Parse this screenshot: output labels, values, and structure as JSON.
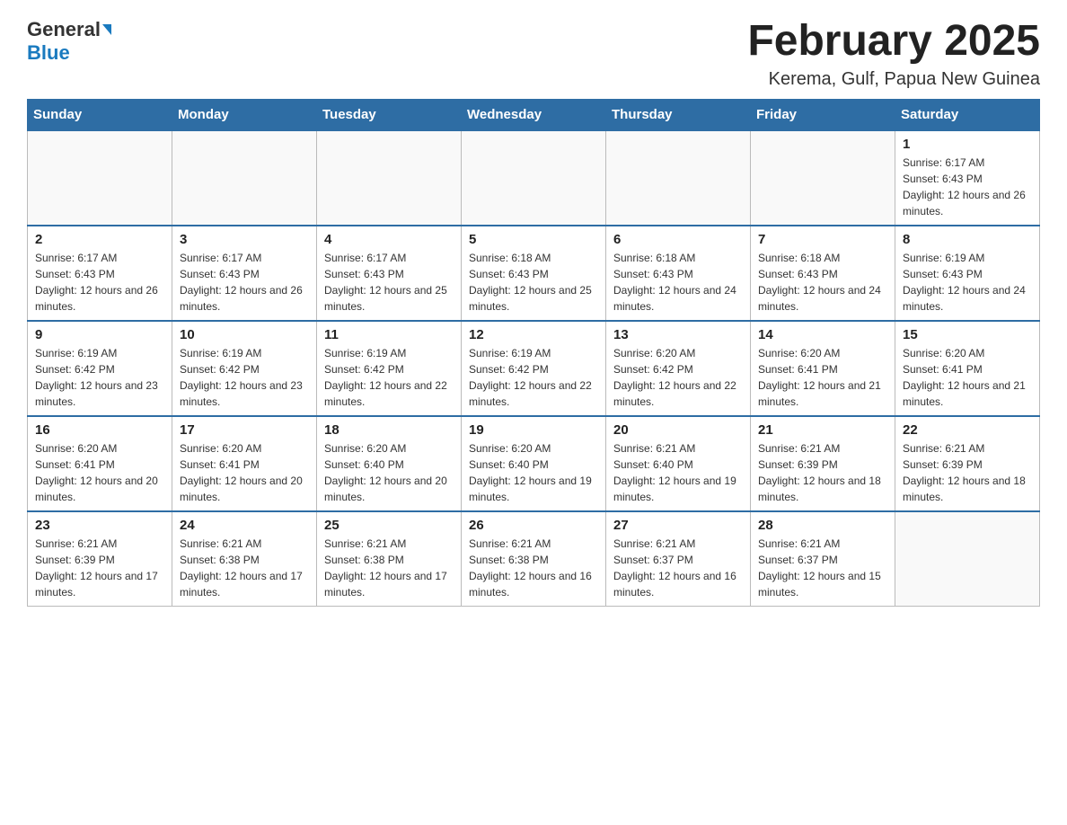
{
  "header": {
    "logo": {
      "general": "General",
      "arrow": "▶",
      "blue": "Blue"
    },
    "title": "February 2025",
    "subtitle": "Kerema, Gulf, Papua New Guinea"
  },
  "calendar": {
    "days_of_week": [
      "Sunday",
      "Monday",
      "Tuesday",
      "Wednesday",
      "Thursday",
      "Friday",
      "Saturday"
    ],
    "weeks": [
      [
        {
          "day": "",
          "info": ""
        },
        {
          "day": "",
          "info": ""
        },
        {
          "day": "",
          "info": ""
        },
        {
          "day": "",
          "info": ""
        },
        {
          "day": "",
          "info": ""
        },
        {
          "day": "",
          "info": ""
        },
        {
          "day": "1",
          "info": "Sunrise: 6:17 AM\nSunset: 6:43 PM\nDaylight: 12 hours and 26 minutes."
        }
      ],
      [
        {
          "day": "2",
          "info": "Sunrise: 6:17 AM\nSunset: 6:43 PM\nDaylight: 12 hours and 26 minutes."
        },
        {
          "day": "3",
          "info": "Sunrise: 6:17 AM\nSunset: 6:43 PM\nDaylight: 12 hours and 26 minutes."
        },
        {
          "day": "4",
          "info": "Sunrise: 6:17 AM\nSunset: 6:43 PM\nDaylight: 12 hours and 25 minutes."
        },
        {
          "day": "5",
          "info": "Sunrise: 6:18 AM\nSunset: 6:43 PM\nDaylight: 12 hours and 25 minutes."
        },
        {
          "day": "6",
          "info": "Sunrise: 6:18 AM\nSunset: 6:43 PM\nDaylight: 12 hours and 24 minutes."
        },
        {
          "day": "7",
          "info": "Sunrise: 6:18 AM\nSunset: 6:43 PM\nDaylight: 12 hours and 24 minutes."
        },
        {
          "day": "8",
          "info": "Sunrise: 6:19 AM\nSunset: 6:43 PM\nDaylight: 12 hours and 24 minutes."
        }
      ],
      [
        {
          "day": "9",
          "info": "Sunrise: 6:19 AM\nSunset: 6:42 PM\nDaylight: 12 hours and 23 minutes."
        },
        {
          "day": "10",
          "info": "Sunrise: 6:19 AM\nSunset: 6:42 PM\nDaylight: 12 hours and 23 minutes."
        },
        {
          "day": "11",
          "info": "Sunrise: 6:19 AM\nSunset: 6:42 PM\nDaylight: 12 hours and 22 minutes."
        },
        {
          "day": "12",
          "info": "Sunrise: 6:19 AM\nSunset: 6:42 PM\nDaylight: 12 hours and 22 minutes."
        },
        {
          "day": "13",
          "info": "Sunrise: 6:20 AM\nSunset: 6:42 PM\nDaylight: 12 hours and 22 minutes."
        },
        {
          "day": "14",
          "info": "Sunrise: 6:20 AM\nSunset: 6:41 PM\nDaylight: 12 hours and 21 minutes."
        },
        {
          "day": "15",
          "info": "Sunrise: 6:20 AM\nSunset: 6:41 PM\nDaylight: 12 hours and 21 minutes."
        }
      ],
      [
        {
          "day": "16",
          "info": "Sunrise: 6:20 AM\nSunset: 6:41 PM\nDaylight: 12 hours and 20 minutes."
        },
        {
          "day": "17",
          "info": "Sunrise: 6:20 AM\nSunset: 6:41 PM\nDaylight: 12 hours and 20 minutes."
        },
        {
          "day": "18",
          "info": "Sunrise: 6:20 AM\nSunset: 6:40 PM\nDaylight: 12 hours and 20 minutes."
        },
        {
          "day": "19",
          "info": "Sunrise: 6:20 AM\nSunset: 6:40 PM\nDaylight: 12 hours and 19 minutes."
        },
        {
          "day": "20",
          "info": "Sunrise: 6:21 AM\nSunset: 6:40 PM\nDaylight: 12 hours and 19 minutes."
        },
        {
          "day": "21",
          "info": "Sunrise: 6:21 AM\nSunset: 6:39 PM\nDaylight: 12 hours and 18 minutes."
        },
        {
          "day": "22",
          "info": "Sunrise: 6:21 AM\nSunset: 6:39 PM\nDaylight: 12 hours and 18 minutes."
        }
      ],
      [
        {
          "day": "23",
          "info": "Sunrise: 6:21 AM\nSunset: 6:39 PM\nDaylight: 12 hours and 17 minutes."
        },
        {
          "day": "24",
          "info": "Sunrise: 6:21 AM\nSunset: 6:38 PM\nDaylight: 12 hours and 17 minutes."
        },
        {
          "day": "25",
          "info": "Sunrise: 6:21 AM\nSunset: 6:38 PM\nDaylight: 12 hours and 17 minutes."
        },
        {
          "day": "26",
          "info": "Sunrise: 6:21 AM\nSunset: 6:38 PM\nDaylight: 12 hours and 16 minutes."
        },
        {
          "day": "27",
          "info": "Sunrise: 6:21 AM\nSunset: 6:37 PM\nDaylight: 12 hours and 16 minutes."
        },
        {
          "day": "28",
          "info": "Sunrise: 6:21 AM\nSunset: 6:37 PM\nDaylight: 12 hours and 15 minutes."
        },
        {
          "day": "",
          "info": ""
        }
      ]
    ]
  }
}
